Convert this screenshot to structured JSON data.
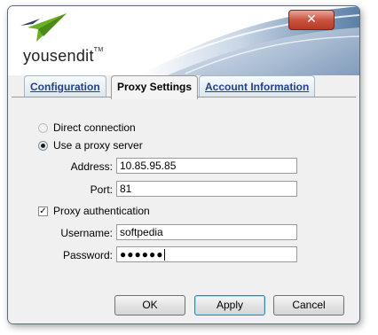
{
  "app": {
    "brand": "yousendit",
    "brand_mark": "TM"
  },
  "window": {
    "close_symbol": "✕"
  },
  "tabs": [
    {
      "label": "Configuration",
      "active": false
    },
    {
      "label": "Proxy Settings",
      "active": true
    },
    {
      "label": "Account Information",
      "active": false
    }
  ],
  "proxy": {
    "direct_connection": {
      "label": "Direct connection",
      "selected": false,
      "enabled": false
    },
    "use_proxy": {
      "label": "Use a proxy server",
      "selected": true
    },
    "address": {
      "label": "Address:",
      "value": "10.85.95.85"
    },
    "port": {
      "label": "Port:",
      "value": "81"
    },
    "proxy_auth": {
      "label": "Proxy authentication",
      "checked": true
    },
    "username": {
      "label": "Username:",
      "value": "softpedia"
    },
    "password": {
      "label": "Password:",
      "value": "●●●●●●"
    }
  },
  "buttons": {
    "ok": "OK",
    "apply": "Apply",
    "cancel": "Cancel"
  },
  "colors": {
    "tab_text": "#24418a",
    "close_button": "#c9543f",
    "swoosh": "#5b7fa6",
    "logo_green": "#6ab023"
  }
}
